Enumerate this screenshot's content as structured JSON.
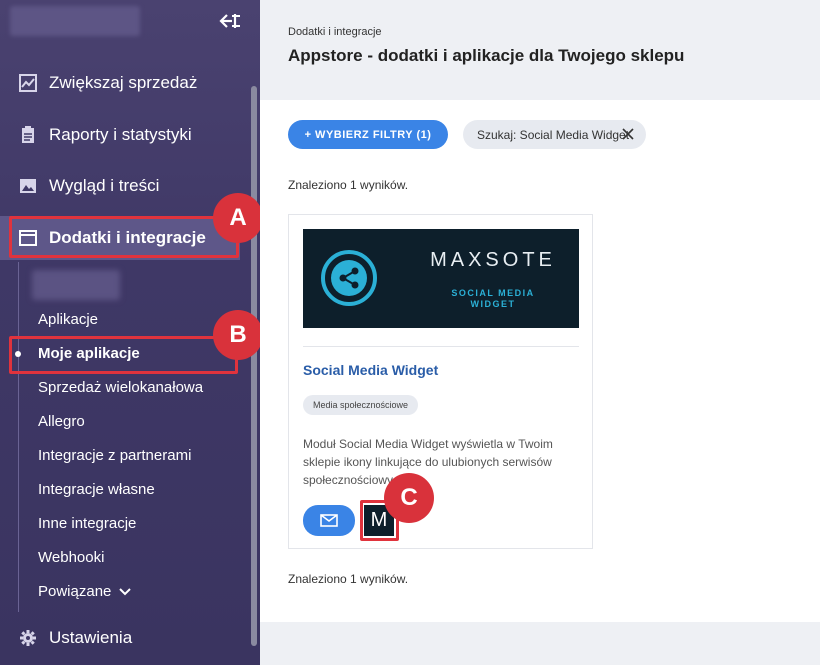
{
  "sidebar": {
    "menu": [
      {
        "label": "Zwiększaj sprzedaż",
        "icon": "chart-line-icon"
      },
      {
        "label": "Raporty i statystyki",
        "icon": "clipboard-icon"
      },
      {
        "label": "Wygląd i treści",
        "icon": "image-icon"
      },
      {
        "label": "Dodatki i integracje",
        "icon": "window-icon"
      }
    ],
    "submenu": [
      "Aplikacje",
      "Moje aplikacje",
      "Sprzedaż wielokanałowa",
      "Allegro",
      "Integracje z partnerami",
      "Integracje własne",
      "Inne integracje",
      "Webhooki",
      "Powiązane"
    ],
    "settings_label": "Ustawienia"
  },
  "badges": {
    "a": "A",
    "b": "B",
    "c": "C"
  },
  "header": {
    "breadcrumb": "Dodatki i integracje",
    "title": "Appstore - dodatki i aplikacje dla Twojego sklepu"
  },
  "filters": {
    "button_label": "+ WYBIERZ FILTRY (1)",
    "chip_label": "Szukaj: Social Media Widget"
  },
  "results": {
    "found_top": "Znaleziono 1 wyników.",
    "found_bottom": "Znaleziono 1 wyników."
  },
  "card": {
    "banner_brand": "MAXSOTE",
    "banner_line1": "SOCIAL MEDIA",
    "banner_line2": "WIDGET",
    "name": "Social Media Widget",
    "tag": "Media społecznościowe",
    "description": "Moduł Social Media Widget wyświetla w Twoim sklepie ikony linkujące do ulubionych serwisów społecznościowych",
    "vendor_letter": "M"
  },
  "colors": {
    "accent": "#3a84e6",
    "badge": "#d9323b",
    "sidebar": "#3f3866",
    "banner": "#0d1f2b"
  }
}
